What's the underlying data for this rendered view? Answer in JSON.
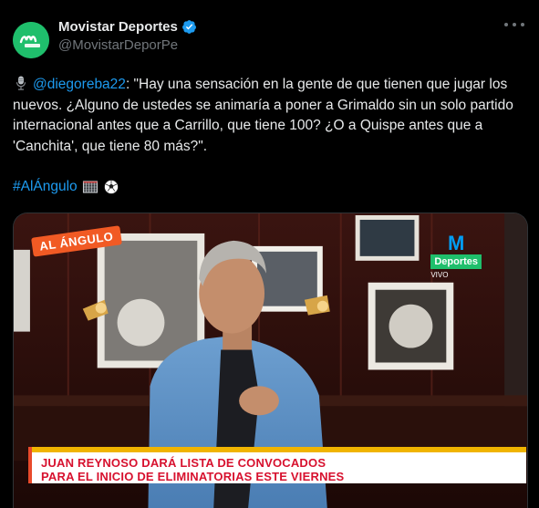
{
  "account": {
    "display_name": "Movistar Deportes",
    "handle": "@MovistarDeporPe",
    "avatar_text": "Movistar Deportes",
    "verified_color": "#1d9bf0",
    "more_label": "More"
  },
  "tweet": {
    "mic_icon": "studio-microphone-icon",
    "mention": "@diegoreba22",
    "quote": ": \"Hay una sensación en la gente de que tienen que jugar los nuevos. ¿Alguno de ustedes se animaría a poner a Grimaldo sin un solo partido internacional antes que a Carrillo, que tiene 100? ¿O a Quispe antes que a 'Canchita', que tiene 80 más?\".",
    "hashtag": "#AlÁngulo",
    "emojis": [
      "goal-net-icon",
      "soccer-ball-icon"
    ]
  },
  "media": {
    "show_badge": "AL ÁNGULO",
    "network_logo": "M",
    "network_name": "Deportes",
    "network_status": "VIVO",
    "headline_line1": "JUAN REYNOSO DARÁ LISTA DE CONVOCADOS",
    "headline_line2": "PARA EL INICIO DE ELIMINATORIAS ESTE VIERNES"
  },
  "colors": {
    "background": "#000000",
    "text": "#e7e9ea",
    "muted": "#71767b",
    "link": "#1d9bf0",
    "brand_green": "#1fbf6c",
    "headline_red": "#d7112e"
  }
}
